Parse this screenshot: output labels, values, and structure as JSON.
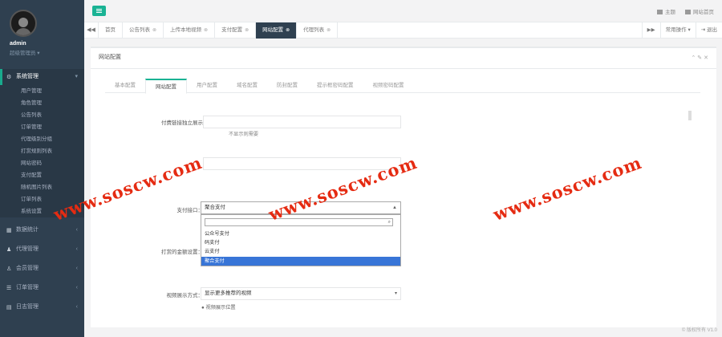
{
  "user": {
    "name": "admin",
    "role": "超级管理员 ▾"
  },
  "sidebar": {
    "groups": [
      {
        "label": "系统管理",
        "icon": "gear-icon"
      },
      {
        "label": "数据统计",
        "icon": "chart-icon"
      },
      {
        "label": "代理管理",
        "icon": "users-icon"
      },
      {
        "label": "会员管理",
        "icon": "user-icon"
      },
      {
        "label": "订单管理",
        "icon": "list-icon"
      },
      {
        "label": "日志管理",
        "icon": "log-icon"
      }
    ],
    "sub_items": [
      "用户管理",
      "角色管理",
      "公告列表",
      "订单管理",
      "代理级别分组",
      "打赏规则列表",
      "网站密码",
      "支付配置",
      "随机图片列表",
      "订单列表",
      "系统设置"
    ]
  },
  "topbar": {
    "messages": "主题",
    "site_home": "网站首页"
  },
  "tabs": {
    "nav_left": "◀◀",
    "items": [
      {
        "label": "首页",
        "close": ""
      },
      {
        "label": "公告列表",
        "close": "⊗"
      },
      {
        "label": "上传本地视频",
        "close": "⊗"
      },
      {
        "label": "支付配置",
        "close": "⊗"
      },
      {
        "label": "网站配置",
        "close": "⊗"
      },
      {
        "label": "代理列表",
        "close": "⊗"
      }
    ],
    "nav_right": "▶▶",
    "ops": "常用操作 ▾",
    "exit": "⇥ 退出"
  },
  "panel": {
    "title": "网站配置",
    "tools": "⌃ ✎ ✕",
    "inner_tabs": [
      "基本配置",
      "网站配置",
      "用户配置",
      "域名配置",
      "防封配置",
      "提示框密码配置",
      "视频密码配置"
    ],
    "fields": {
      "f1_label": "付费链接独立展示",
      "f1_hint": "不显示则需要",
      "f2_label": "支付接口：",
      "f2_value": "聚合支付",
      "f3_label": "打赏的金额设置：",
      "f4_label": "视频展示方式：",
      "f4_value": "显示更多推荐的视频",
      "f4_help": "● 视频展示位置"
    },
    "dropdown": {
      "search_icon": "🔍",
      "options": [
        "公众号支付",
        "码支付",
        "云支付",
        "聚合支付"
      ],
      "selected": "聚合支付"
    }
  },
  "watermark": "www.soscw.com",
  "footer": "© 版权所有 V1.0"
}
